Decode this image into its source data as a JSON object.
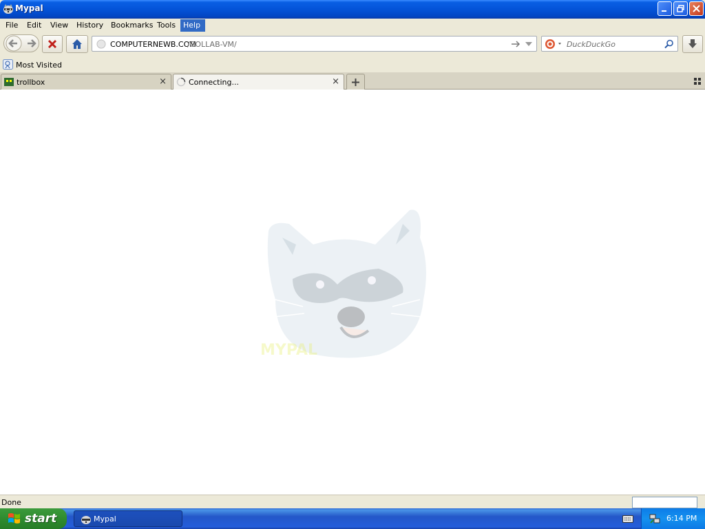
{
  "window": {
    "title": "Mypal",
    "icon": "raccoon-icon"
  },
  "menubar": {
    "items": [
      {
        "label": "File"
      },
      {
        "label": "Edit"
      },
      {
        "label": "View"
      },
      {
        "label": "History"
      },
      {
        "label": "Bookmarks"
      },
      {
        "label": "Tools"
      },
      {
        "label": "Help",
        "active": true
      }
    ]
  },
  "navigation": {
    "url_host": "COMPUTERNEWB.COM",
    "url_path": "/COLLAB-VM/",
    "search_placeholder": "DuckDuckGo"
  },
  "bookmarks": {
    "items": [
      {
        "label": "Most Visited"
      }
    ]
  },
  "tabs": [
    {
      "label": "trollbox",
      "selected": false
    },
    {
      "label": "Connecting...",
      "selected": true
    }
  ],
  "status": {
    "text": "Done"
  },
  "taskbar": {
    "start_label": "start",
    "tasks": [
      {
        "label": "Mypal"
      }
    ],
    "clock": "6:14 PM"
  },
  "colors": {
    "title_blue": "#0453d8",
    "taskbar_blue": "#245edb",
    "start_green": "#2f8b2f",
    "menu_highlight": "#316ac5"
  }
}
